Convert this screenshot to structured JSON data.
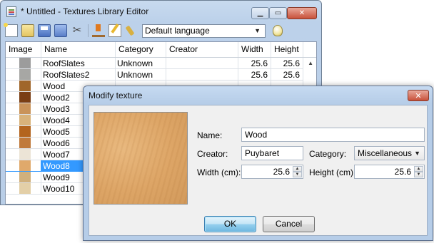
{
  "main_window": {
    "title": "* Untitled - Textures Library Editor",
    "caption_buttons": [
      "minimize",
      "maximize",
      "close"
    ],
    "toolbar": {
      "icons": [
        "new-icon",
        "open-icon",
        "save-icon",
        "save-as-icon",
        "cut-icon",
        "import-icon",
        "modify-icon",
        "delete-icon",
        "help-icon"
      ],
      "language_value": "Default language"
    },
    "table": {
      "columns": [
        "Image",
        "Name",
        "Category",
        "Creator",
        "Width",
        "Height"
      ],
      "rows": [
        {
          "name": "RoofSlates",
          "category": "Unknown",
          "creator": "",
          "width": "25.6",
          "height": "25.6",
          "color": "#9c9c9c"
        },
        {
          "name": "RoofSlates2",
          "category": "Unknown",
          "creator": "",
          "width": "25.6",
          "height": "25.6",
          "color": "#a7a7a4"
        },
        {
          "name": "Wood",
          "category": "",
          "creator": "",
          "width": "",
          "height": "",
          "color": "#a0662a"
        },
        {
          "name": "Wood2",
          "category": "",
          "creator": "",
          "width": "",
          "height": "",
          "color": "#7a3e14"
        },
        {
          "name": "Wood3",
          "category": "",
          "creator": "",
          "width": "",
          "height": "",
          "color": "#c9935a"
        },
        {
          "name": "Wood4",
          "category": "",
          "creator": "",
          "width": "",
          "height": "",
          "color": "#d8b27a"
        },
        {
          "name": "Wood5",
          "category": "",
          "creator": "",
          "width": "",
          "height": "",
          "color": "#b3641e"
        },
        {
          "name": "Wood6",
          "category": "",
          "creator": "",
          "width": "",
          "height": "",
          "color": "#c07a3c"
        },
        {
          "name": "Wood7",
          "category": "",
          "creator": "",
          "width": "",
          "height": "",
          "color": "#ece4d6"
        },
        {
          "name": "Wood8",
          "category": "",
          "creator": "",
          "width": "",
          "height": "",
          "color": "#e0a96b",
          "selected": true
        },
        {
          "name": "Wood9",
          "category": "",
          "creator": "",
          "width": "",
          "height": "",
          "color": "#d0b07c"
        },
        {
          "name": "Wood10",
          "category": "",
          "creator": "",
          "width": "",
          "height": "",
          "color": "#e3cfa7"
        }
      ]
    }
  },
  "dialog": {
    "title": "Modify texture",
    "preview_color": "#dca468",
    "name_label": "Name:",
    "name_value": "Wood",
    "creator_label": "Creator:",
    "creator_value": "Puybaret",
    "category_label": "Category:",
    "category_value": "Miscellaneous",
    "width_label": "Width (cm):",
    "width_value": "25.6",
    "height_label": "Height (cm):",
    "height_value": "25.6",
    "ok_label": "OK",
    "cancel_label": "Cancel"
  }
}
